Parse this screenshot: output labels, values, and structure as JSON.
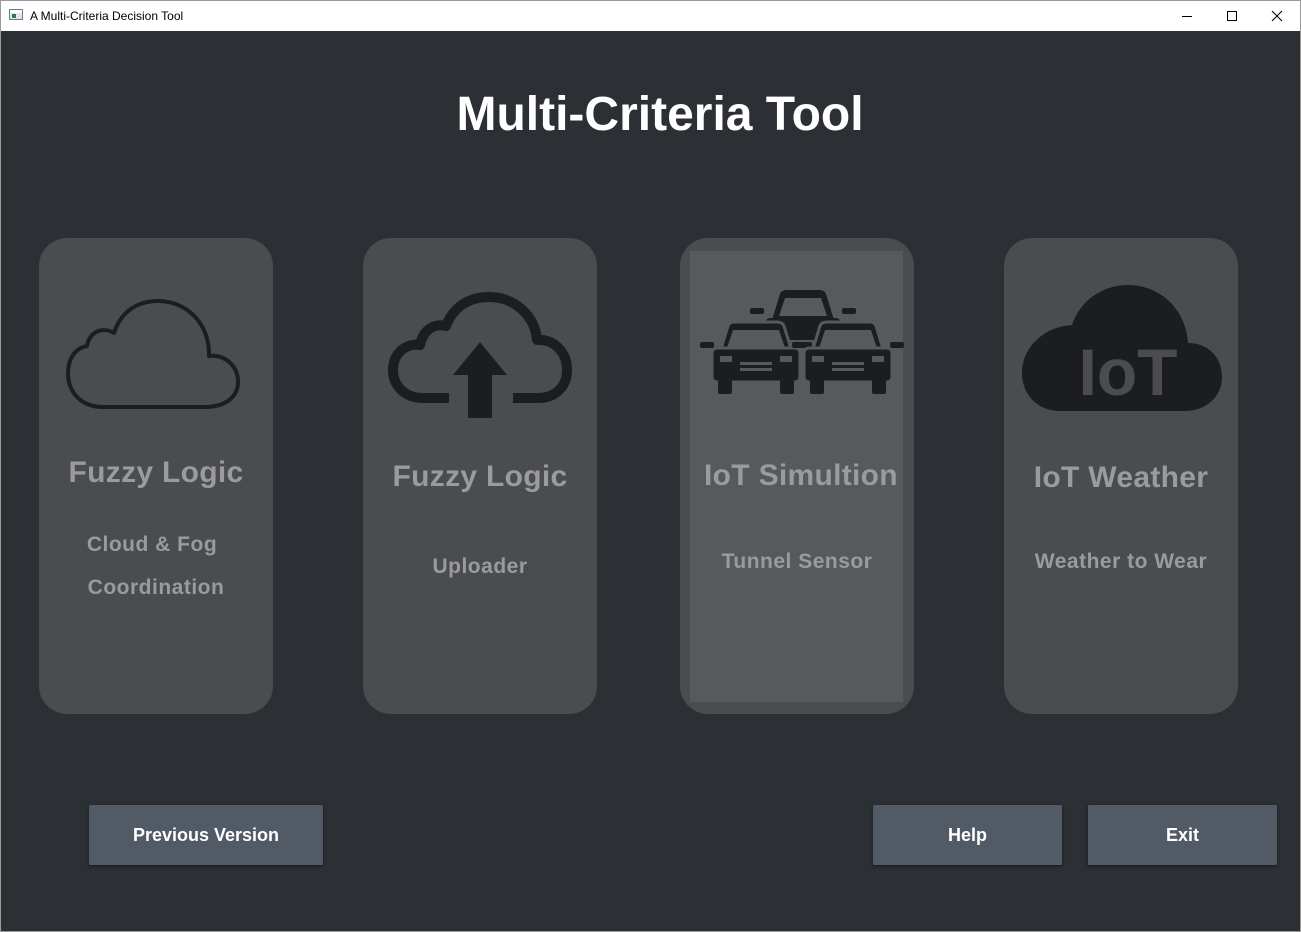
{
  "window": {
    "title": "A Multi-Criteria Decision Tool"
  },
  "main": {
    "title": "Multi-Criteria Tool"
  },
  "cards": [
    {
      "icon": "cloud-outline-icon",
      "title": "Fuzzy Logic",
      "subtitle_line1": "Cloud & Fog",
      "subtitle_line2": "Coordination"
    },
    {
      "icon": "cloud-upload-icon",
      "title": "Fuzzy Logic",
      "subtitle_line1": "Uploader"
    },
    {
      "icon": "cars-traffic-icon",
      "title": "IoT Simultion",
      "subtitle_line1": "Tunnel Sensor"
    },
    {
      "icon": "iot-cloud-icon",
      "icon_text": "IoT",
      "title": "IoT Weather",
      "subtitle_line1": "Weather to Wear"
    }
  ],
  "buttons": {
    "previous": "Previous Version",
    "help": "Help",
    "exit": "Exit"
  },
  "colors": {
    "background": "#2c2f34",
    "card": "#4b4c4f",
    "card_hover": "#58595c",
    "card_text": "#9a9b9d",
    "icon": "#1c1d1f",
    "button": "#525a66",
    "title": "#ffffff"
  }
}
